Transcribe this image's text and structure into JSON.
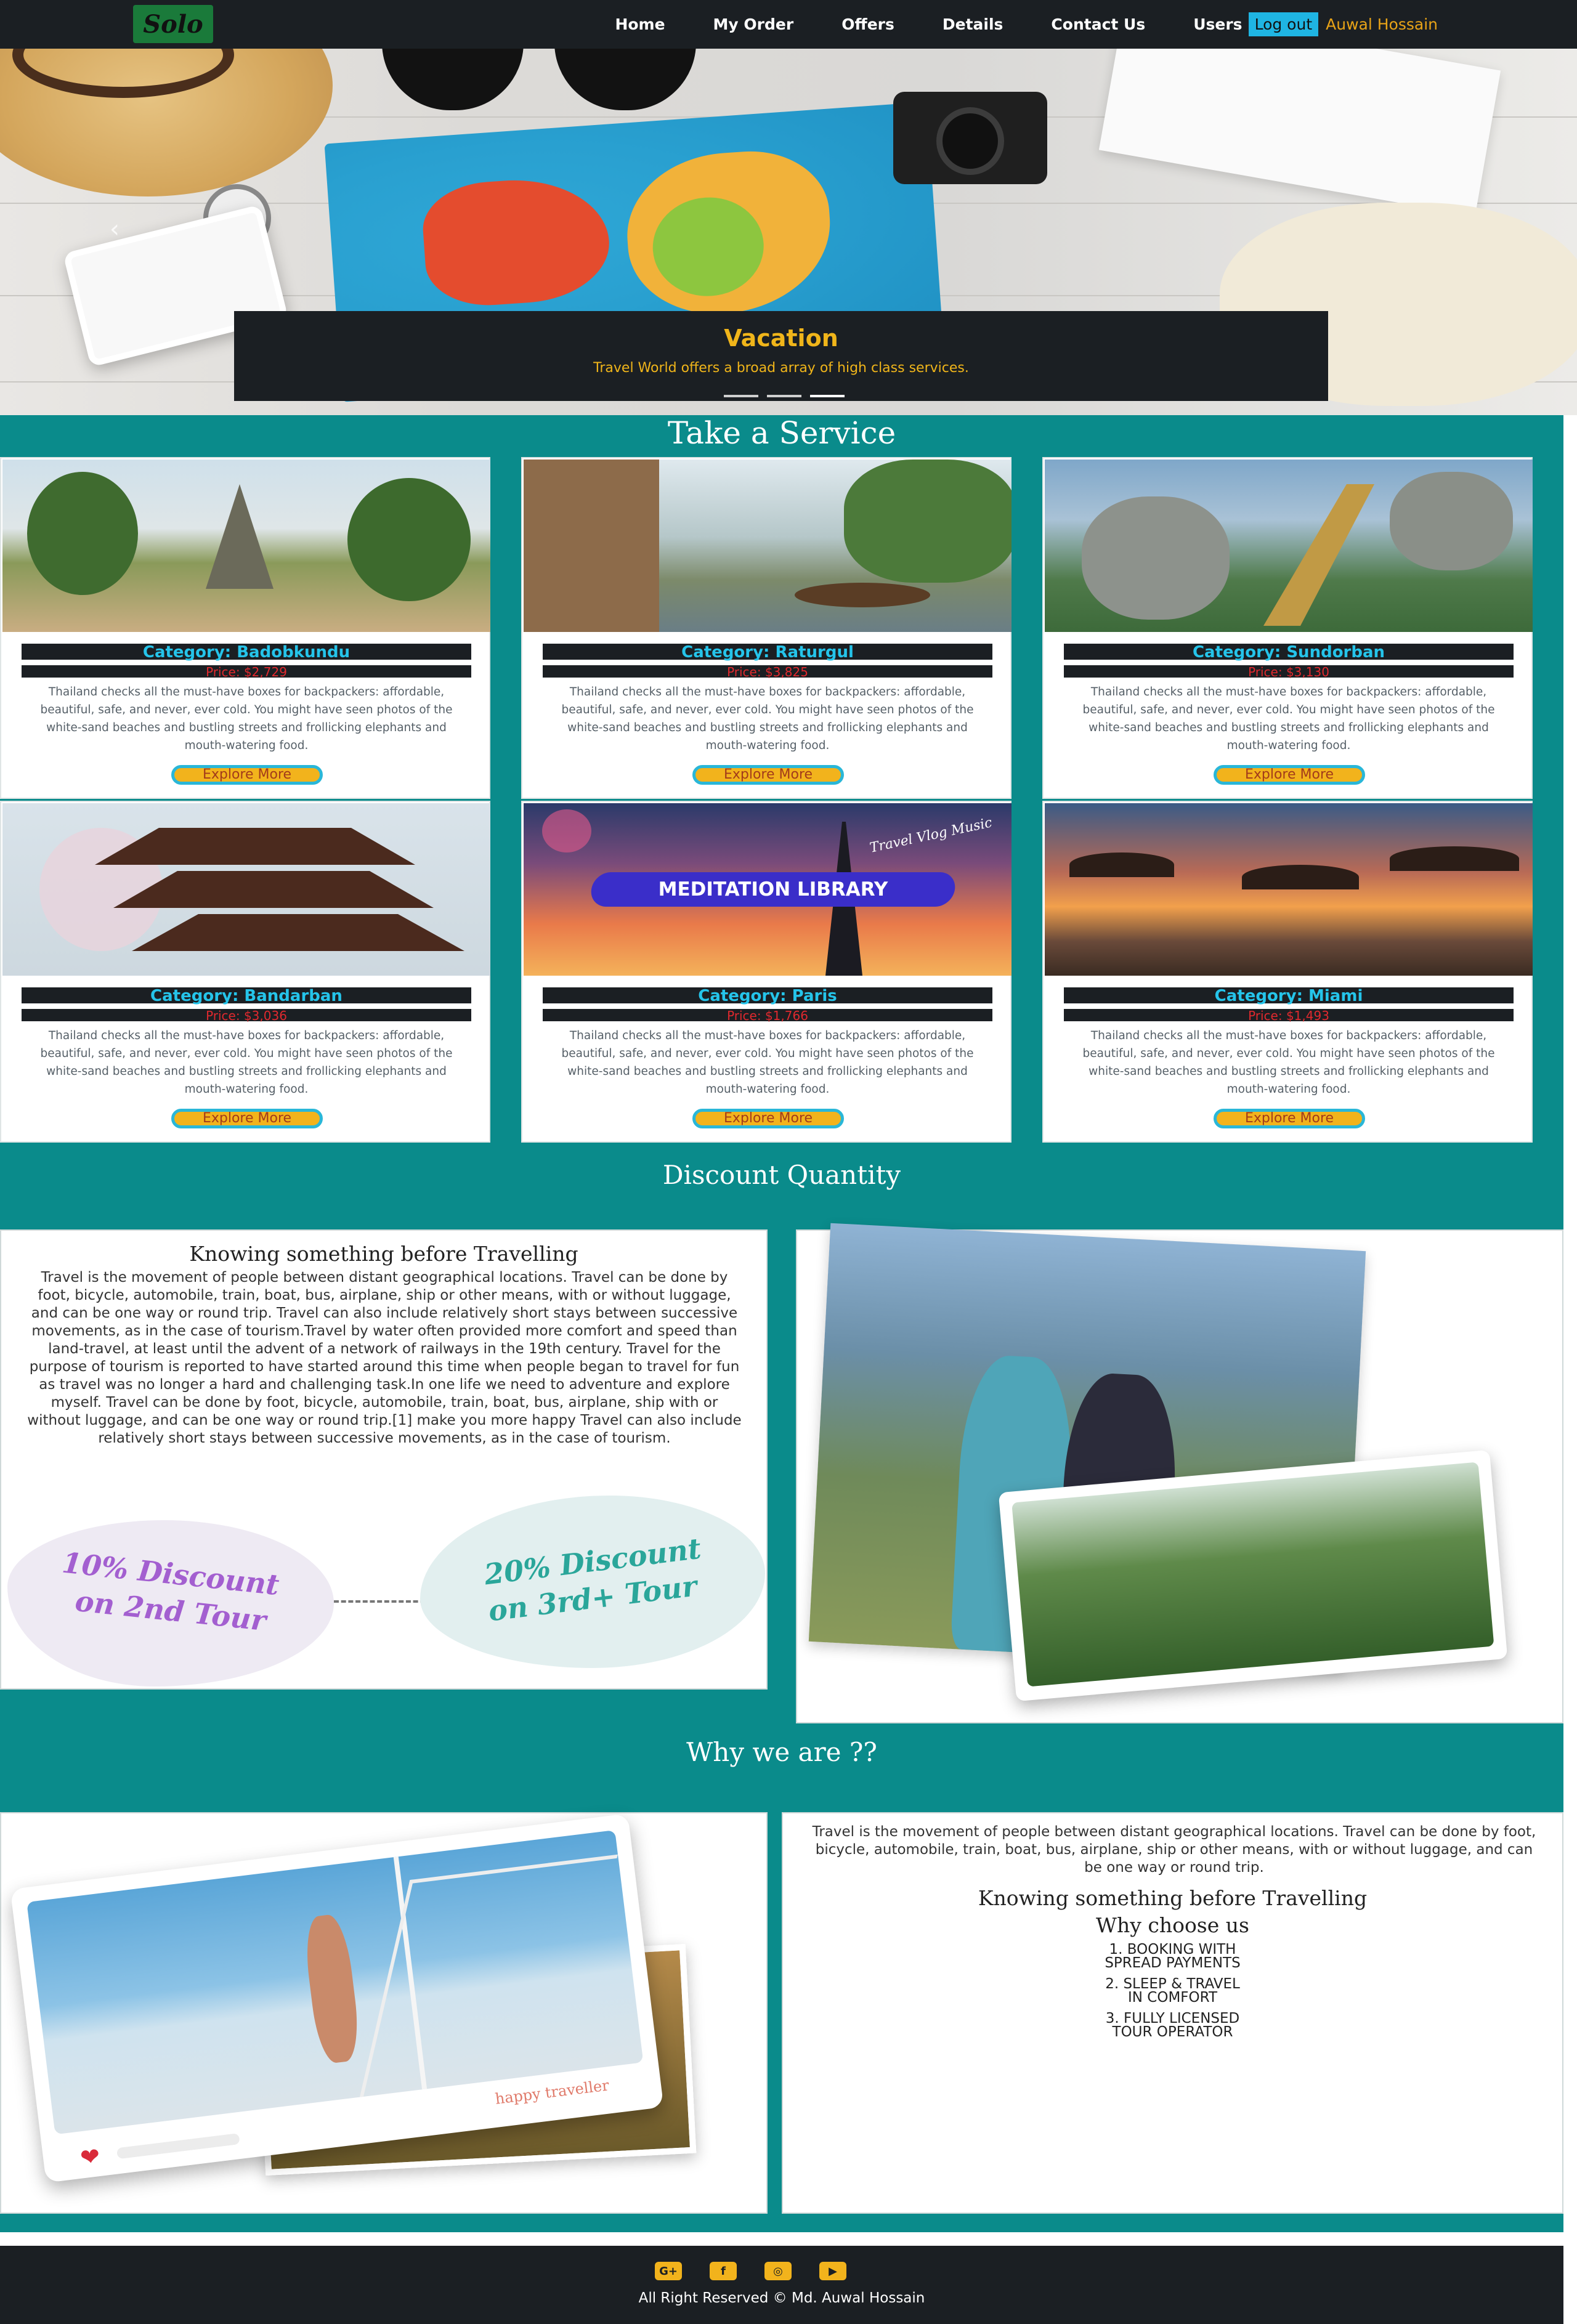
{
  "nav": {
    "logo": "Solo",
    "links": [
      "Home",
      "My Order",
      "Offers",
      "Details",
      "Contact Us",
      "Users"
    ],
    "logout_label": "Log out",
    "user_name": "Auwal Hossain"
  },
  "hero": {
    "title": "Vacation",
    "subtitle": "Travel World offers a broad array of high class services.",
    "slides": 3,
    "active_slide": 3
  },
  "services": {
    "title": "Take a Service",
    "cards": [
      {
        "category": "Category: Badobkundu",
        "price": "Price: $2,729",
        "description": "Thailand checks all the must-have boxes for backpackers: affordable, beautiful, safe, and never, ever cold. You might have seen photos of the white-sand beaches and bustling streets and frollicking elephants and mouth-watering food.",
        "button": "Explore More"
      },
      {
        "category": "Category: Raturgul",
        "price": "Price: $3,825",
        "description": "Thailand checks all the must-have boxes for backpackers: affordable, beautiful, safe, and never, ever cold. You might have seen photos of the white-sand beaches and bustling streets and frollicking elephants and mouth-watering food.",
        "button": "Explore More"
      },
      {
        "category": "Category: Sundorban",
        "price": "Price: $3,130",
        "description": "Thailand checks all the must-have boxes for backpackers: affordable, beautiful, safe, and never, ever cold. You might have seen photos of the white-sand beaches and bustling streets and frollicking elephants and mouth-watering food.",
        "button": "Explore More"
      },
      {
        "category": "Category: Bandarban",
        "price": "Price: $3,036",
        "description": "Thailand checks all the must-have boxes for backpackers: affordable, beautiful, safe, and never, ever cold. You might have seen photos of the white-sand beaches and bustling streets and frollicking elephants and mouth-watering food.",
        "button": "Explore More"
      },
      {
        "category": "Category: Paris",
        "price": "Price: $1,766",
        "description": "Thailand checks all the must-have boxes for backpackers: affordable, beautiful, safe, and never, ever cold. You might have seen photos of the white-sand beaches and bustling streets and frollicking elephants and mouth-watering food.",
        "button": "Explore More",
        "image_overlay": "MEDITATION LIBRARY",
        "image_script": "Travel Vlog Music"
      },
      {
        "category": "Category: Miami",
        "price": "Price: $1,493",
        "description": "Thailand checks all the must-have boxes for backpackers: affordable, beautiful, safe, and never, ever cold. You might have seen photos of the white-sand beaches and bustling streets and frollicking elephants and mouth-watering food.",
        "button": "Explore More"
      }
    ]
  },
  "discount": {
    "title": "Discount Quantity",
    "heading": "Knowing something before Travelling",
    "body": "Travel is the movement of people between distant geographical locations. Travel can be done by foot, bicycle, automobile, train, boat, bus, airplane, ship or other means, with or without luggage, and can be one way or round trip. Travel can also include relatively short stays between successive movements, as in the case of tourism.Travel by water often provided more comfort and speed than land-travel, at least until the advent of a network of railways in the 19th century. Travel for the purpose of tourism is reported to have started around this time when people began to travel for fun as travel was no longer a hard and challenging task.In one life we need to adventure and explore myself. Travel can be done by foot, bicycle, automobile, train, boat, bus, airplane, ship with or without luggage, and can be one way or round trip.[1] make you more happy Travel can also include relatively short stays between successive movements, as in the case of tourism.",
    "offer1_line1": "10% Discount",
    "offer1_line2": "on 2nd Tour",
    "offer2_line1": "20% Discount",
    "offer2_line2": "on 3rd+ Tour"
  },
  "why": {
    "title": "Why we are ??",
    "photo_caption": "happy traveller",
    "body": "Travel is the movement of people between distant geographical locations. Travel can be done by foot, bicycle, automobile, train, boat, bus, airplane, ship or other means, with or without luggage, and can be one way or round trip.",
    "heading": "Knowing something before Travelling",
    "subheading": "Why choose us",
    "points": [
      [
        "1. BOOKING WITH",
        "SPREAD PAYMENTS"
      ],
      [
        "2. SLEEP & TRAVEL",
        "IN COMFORT"
      ],
      [
        "3. FULLY LICENSED",
        "TOUR OPERATOR"
      ]
    ]
  },
  "footer": {
    "icons": [
      "google-plus-icon",
      "facebook-icon",
      "instagram-icon",
      "youtube-icon"
    ],
    "icon_glyphs": [
      "G+",
      "f",
      "◎",
      "▶"
    ],
    "copyright": "All Right Reserved © Md. Auwal Hossain"
  },
  "colors": {
    "nav_bg": "#1b1f23",
    "teal": "#0a8b8b",
    "accent_yellow": "#f2b31c",
    "accent_cyan": "#25c4ea",
    "price_red": "#e0292e",
    "logo_green": "#1a7a3a"
  }
}
